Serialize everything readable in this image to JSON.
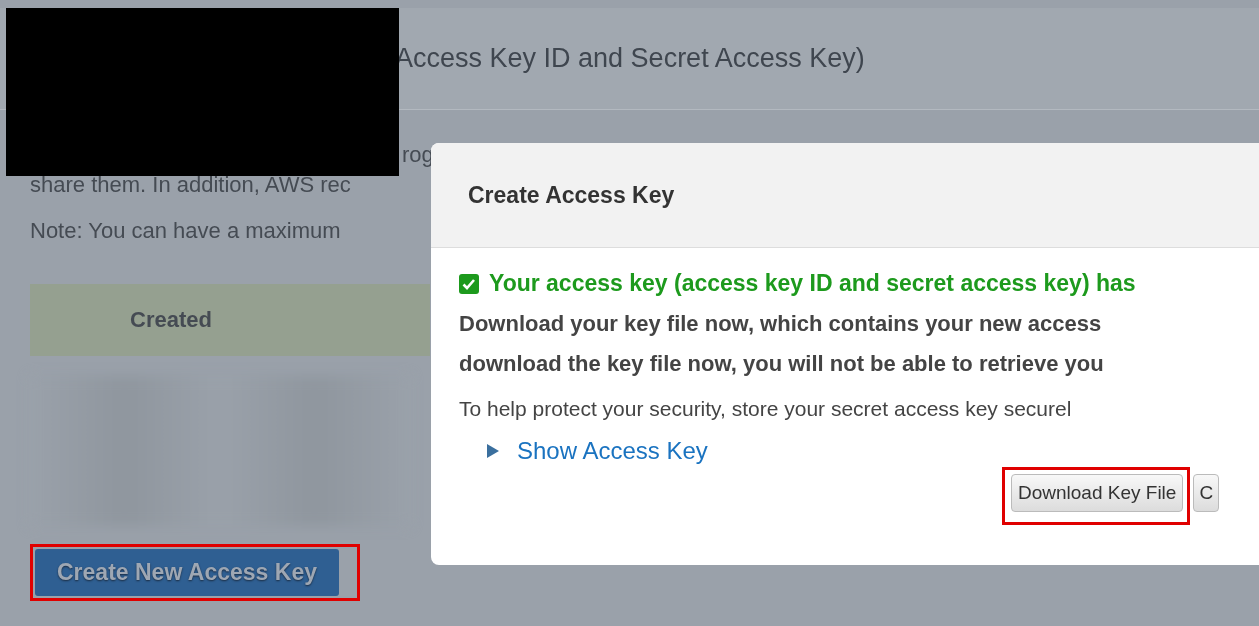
{
  "page": {
    "heading": "Access Key ID and Secret Access Key)",
    "intro_fragment": "rog",
    "intro_line": "share them. In addition, AWS rec",
    "note": "Note: You can have a maximum",
    "table": {
      "columns": [
        "Created"
      ]
    },
    "create_button": "Create New Access Key"
  },
  "dialog": {
    "title": "Create Access Key",
    "success": "Your access key (access key ID and secret access key) has",
    "warning_lines": [
      "Download your key file now, which contains your new access",
      "download the key file now, you will not be able to retrieve you"
    ],
    "tip": "To help protect your security, store your secret access key securel",
    "disclosure": {
      "label": "Show Access Key",
      "expanded": false
    },
    "buttons": [
      {
        "label": "Download Key File",
        "highlighted": true
      },
      {
        "label": "C",
        "highlighted": false
      }
    ]
  }
}
